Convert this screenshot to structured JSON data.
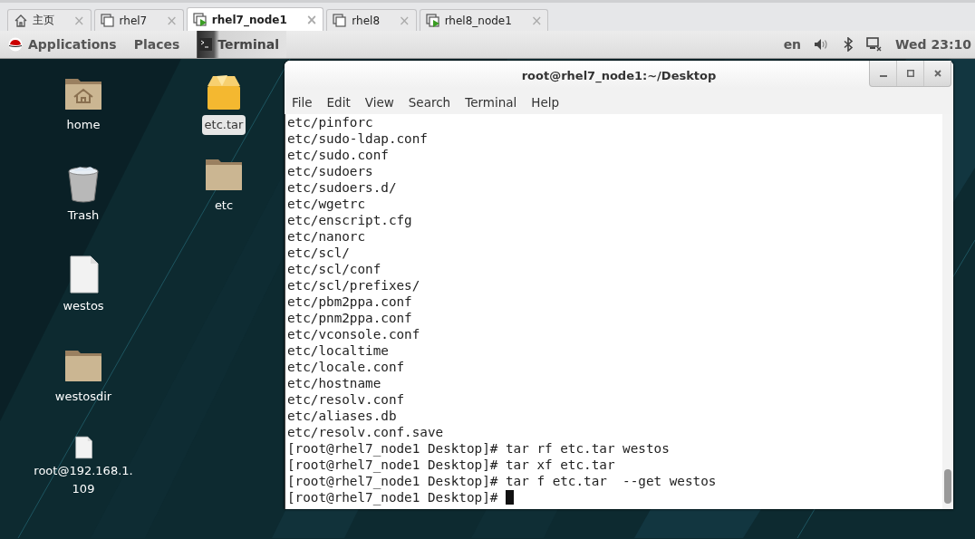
{
  "tabs": [
    {
      "label": "主页",
      "kind": "home",
      "selected": false
    },
    {
      "label": "rhel7",
      "kind": "vm",
      "selected": false
    },
    {
      "label": "rhel7_node1",
      "kind": "vm-running",
      "selected": true
    },
    {
      "label": "rhel8",
      "kind": "vm",
      "selected": false
    },
    {
      "label": "rhel8_node1",
      "kind": "vm-running",
      "selected": false
    }
  ],
  "tab_close": "×",
  "top_panel": {
    "menus": [
      "Applications",
      "Places"
    ],
    "app": "Terminal",
    "keyboard": "en",
    "clock": "Wed 23:10"
  },
  "desktop_columns": [
    {
      "icons": [
        {
          "label": "home",
          "kind": "home-folder",
          "selected": false
        },
        {
          "label": "Trash",
          "kind": "trash",
          "selected": false
        },
        {
          "label": "westos",
          "kind": "file",
          "selected": false
        },
        {
          "label": "westosdir",
          "kind": "folder",
          "selected": false
        },
        {
          "label": "root@192.168.1.\n109",
          "kind": "file",
          "selected": false
        }
      ]
    },
    {
      "icons": [
        {
          "label": "etc.tar",
          "kind": "archive",
          "selected": true
        },
        {
          "label": "etc",
          "kind": "folder",
          "selected": false
        }
      ]
    }
  ],
  "terminal": {
    "title": "root@rhel7_node1:~/Desktop",
    "menu": [
      "File",
      "Edit",
      "View",
      "Search",
      "Terminal",
      "Help"
    ],
    "lines": [
      "etc/pinforc",
      "etc/sudo-ldap.conf",
      "etc/sudo.conf",
      "etc/sudoers",
      "etc/sudoers.d/",
      "etc/wgetrc",
      "etc/enscript.cfg",
      "etc/nanorc",
      "etc/scl/",
      "etc/scl/conf",
      "etc/scl/prefixes/",
      "etc/pbm2ppa.conf",
      "etc/pnm2ppa.conf",
      "etc/vconsole.conf",
      "etc/localtime",
      "etc/locale.conf",
      "etc/hostname",
      "etc/resolv.conf",
      "etc/aliases.db",
      "etc/resolv.conf.save",
      "[root@rhel7_node1 Desktop]# tar rf etc.tar westos",
      "[root@rhel7_node1 Desktop]# tar xf etc.tar",
      "[root@rhel7_node1 Desktop]# tar f etc.tar  --get westos",
      "[root@rhel7_node1 Desktop]# "
    ],
    "cursor": true
  }
}
